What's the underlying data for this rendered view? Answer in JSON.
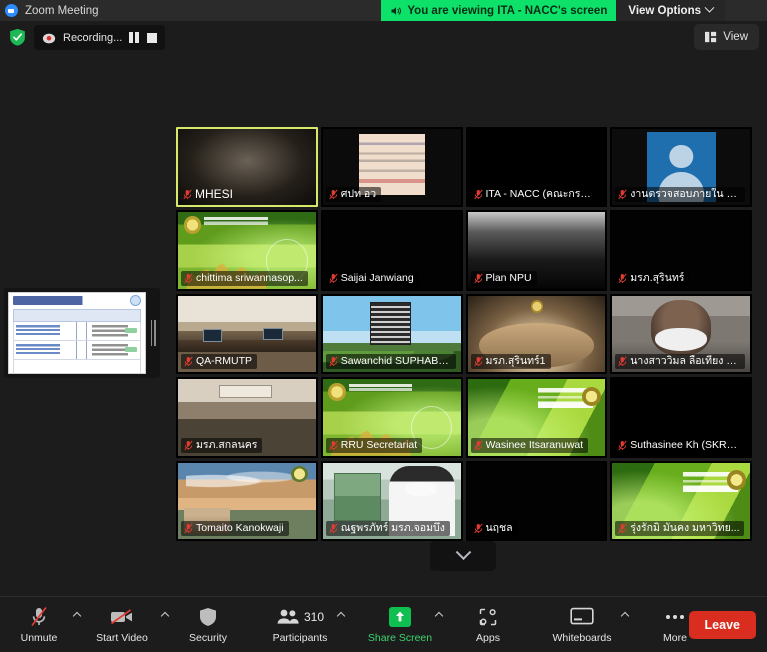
{
  "window": {
    "title": "Zoom Meeting",
    "logo_icon": "zoom-logo-icon"
  },
  "sharing_banner": {
    "icon": "speaker-icon",
    "text": "You are viewing ITA - NACC's screen"
  },
  "view_options": {
    "label": "View Options",
    "caret_icon": "chevron-down-icon"
  },
  "recording": {
    "encryption_icon": "green-shield-icon",
    "record_icon": "recording-dot-icon",
    "label": "Recording...",
    "pause_icon": "pause-icon",
    "stop_icon": "stop-icon"
  },
  "view_button": {
    "icon": "view-layout-icon",
    "label": "View"
  },
  "shared_screen_thumbnail": {
    "name": "floating-share-thumbnail",
    "drag_handle_icon": "drag-handle-icon"
  },
  "gallery": {
    "columns": 4,
    "rows": 5,
    "next_page_icon": "chevron-down-icon",
    "participants": [
      {
        "name": "MHESI",
        "muted": true,
        "active_speaker": true,
        "bg": "bg-room-dark"
      },
      {
        "name": "ศปท อว",
        "muted": true,
        "active_speaker": false,
        "bg": "bg-doc"
      },
      {
        "name": "ITA - NACC (คณะกรรมการ)",
        "muted": true,
        "active_speaker": false,
        "bg": "bg-banner-dark"
      },
      {
        "name": "งานตรวจสอบภายใน งา...",
        "muted": true,
        "active_speaker": false,
        "bg": "bg-avatar"
      },
      {
        "name": "chittima sriwannasop...",
        "muted": true,
        "active_speaker": false,
        "bg": "bg-green-uni"
      },
      {
        "name": "Saijai Janwiang",
        "muted": true,
        "active_speaker": false,
        "bg": "bg-black"
      },
      {
        "name": "Plan NPU",
        "muted": true,
        "active_speaker": false,
        "bg": "bg-fog"
      },
      {
        "name": "มรภ.สุรินทร์",
        "muted": true,
        "active_speaker": false,
        "bg": "bg-black"
      },
      {
        "name": "QA-RMUTP",
        "muted": true,
        "active_speaker": false,
        "bg": "bg-office"
      },
      {
        "name": "Sawanchid SUPHABW...",
        "muted": true,
        "active_speaker": false,
        "bg": "bg-city"
      },
      {
        "name": "มรภ.สุรินทร์1",
        "muted": true,
        "active_speaker": false,
        "bg": "bg-conf"
      },
      {
        "name": "นางสาววิมล ลือเทียง ม...",
        "muted": true,
        "active_speaker": false,
        "bg": "bg-portrait"
      },
      {
        "name": "มรภ.สกลนคร",
        "muted": true,
        "active_speaker": false,
        "bg": "bg-hall"
      },
      {
        "name": "RRU Secretariat",
        "muted": true,
        "active_speaker": false,
        "bg": "bg-green-uni"
      },
      {
        "name": "Wasinee Itsaranuwat",
        "muted": true,
        "active_speaker": false,
        "bg": "bg-rru"
      },
      {
        "name": "Suthasinee Kh (SKRU ...",
        "muted": true,
        "active_speaker": false,
        "bg": "bg-hospital"
      },
      {
        "name": "Tomaito Kanokwaji",
        "muted": true,
        "active_speaker": false,
        "bg": "bg-sunset"
      },
      {
        "name": "ณฐพรภัทร์ มรภ.จอมบึง",
        "muted": true,
        "active_speaker": false,
        "bg": "bg-clinic"
      },
      {
        "name": "นฤชล",
        "muted": true,
        "active_speaker": false,
        "bg": "bg-black"
      },
      {
        "name": "รุ่งรักมิ มั่นคง มหาวิทย...",
        "muted": true,
        "active_speaker": false,
        "bg": "bg-rru"
      }
    ]
  },
  "toolbar": {
    "unmute": {
      "label": "Unmute",
      "icon": "microphone-muted-icon",
      "has_caret": true
    },
    "start_video": {
      "label": "Start Video",
      "icon": "video-off-icon",
      "has_caret": true
    },
    "security": {
      "label": "Security",
      "icon": "shield-icon",
      "has_caret": false
    },
    "participants": {
      "label": "Participants",
      "icon": "participants-icon",
      "count": "310",
      "has_caret": true
    },
    "share_screen": {
      "label": "Share Screen",
      "icon": "share-screen-icon",
      "has_caret": true
    },
    "apps": {
      "label": "Apps",
      "icon": "apps-icon",
      "has_caret": false
    },
    "whiteboards": {
      "label": "Whiteboards",
      "icon": "whiteboard-icon",
      "has_caret": true
    },
    "more": {
      "label": "More",
      "icon": "more-dots-icon",
      "has_caret": false
    },
    "leave": {
      "label": "Leave"
    }
  },
  "colors": {
    "banner_green": "#0ee16a",
    "share_green": "#3dd66f",
    "leave_red": "#d92d20",
    "active_border": "#d6e96a",
    "mute_red": "#e23b32"
  }
}
